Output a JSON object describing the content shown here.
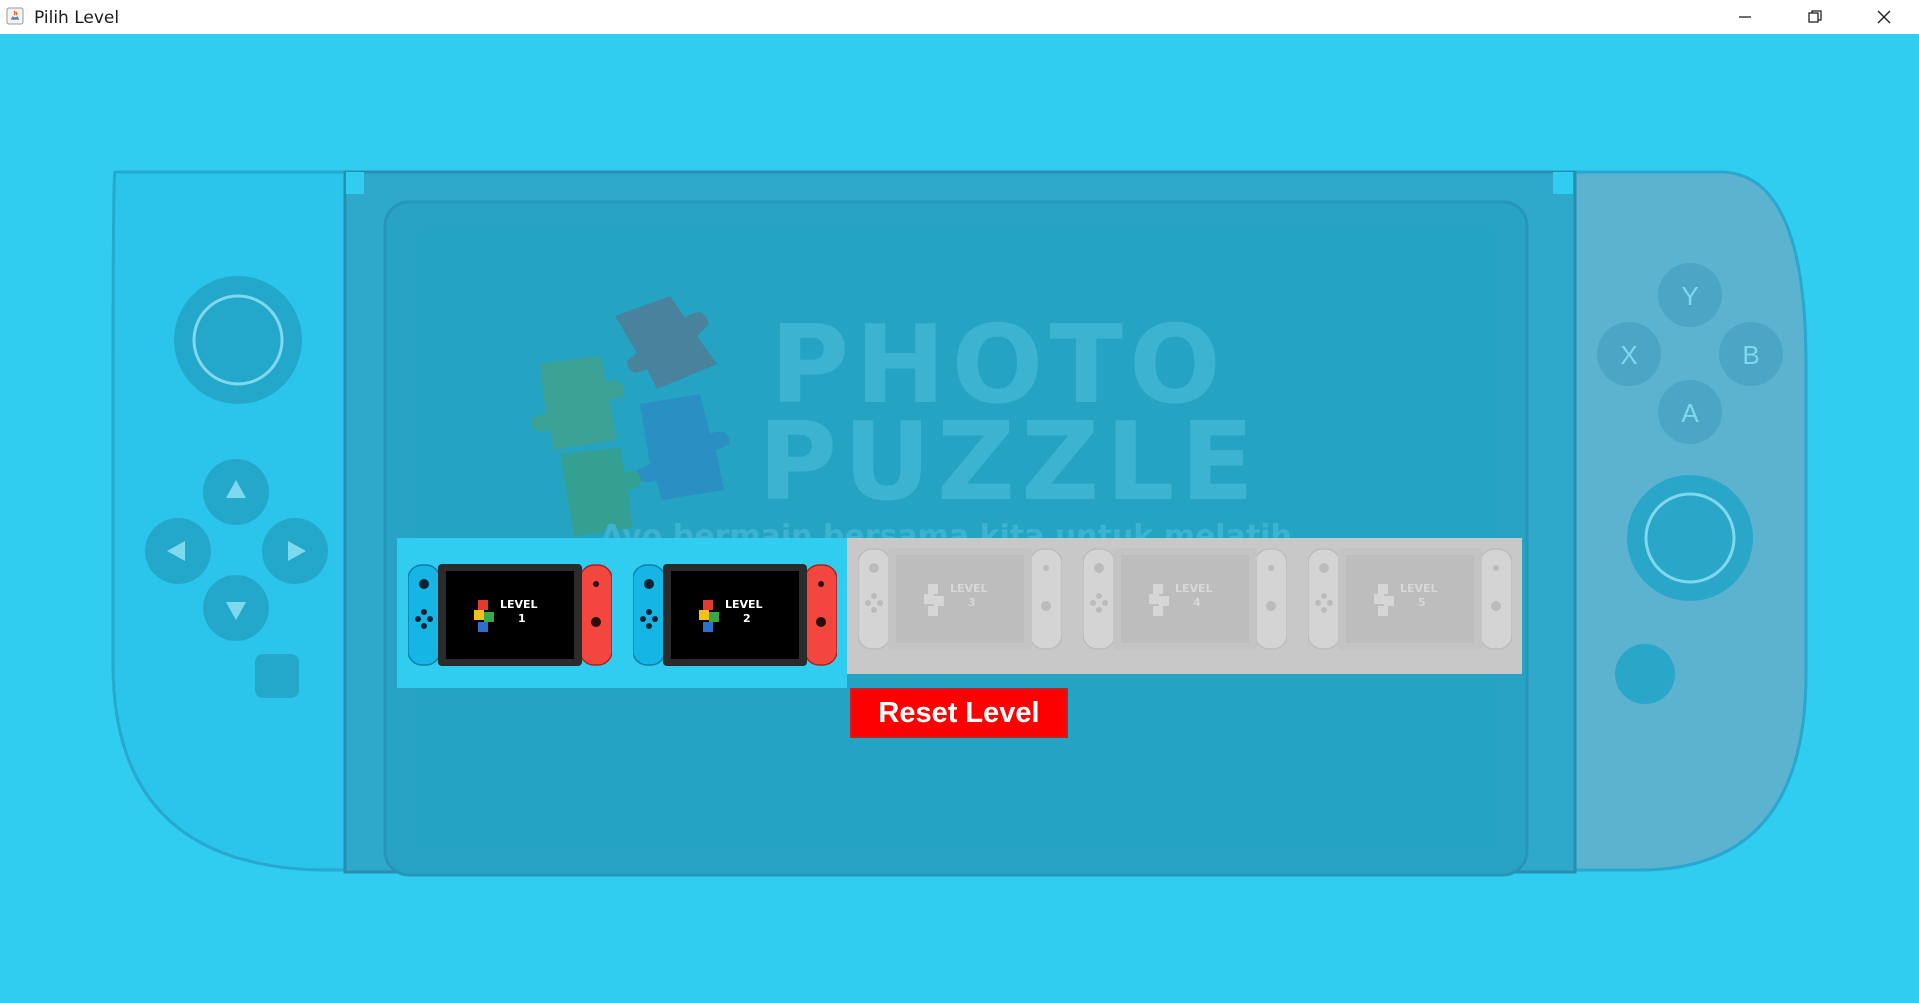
{
  "window": {
    "title": "Pilih Level",
    "controls": [
      "minimize",
      "restore",
      "close"
    ]
  },
  "background": {
    "title_line1": "PHOTO",
    "title_line2": "PUZZLE",
    "subtitle": "Ayo bermain bersama kita untuk melatih"
  },
  "controller": {
    "face_buttons": {
      "top": "Y",
      "left": "X",
      "right": "B",
      "bottom": "A"
    }
  },
  "levels": [
    {
      "label": "LEVEL",
      "number": "1",
      "unlocked": true
    },
    {
      "label": "LEVEL",
      "number": "2",
      "unlocked": true
    },
    {
      "label": "LEVEL",
      "number": "3",
      "unlocked": false
    },
    {
      "label": "LEVEL",
      "number": "4",
      "unlocked": false
    },
    {
      "label": "LEVEL",
      "number": "5",
      "unlocked": false
    }
  ],
  "reset_button": {
    "label": "Reset Level"
  },
  "colors": {
    "background": "#31cdf0",
    "console_body": "#2a9fc0",
    "screen": "#25a3c2",
    "reset": "#ff0000",
    "joycon_left": "#15b6e6",
    "joycon_right": "#f2463f"
  }
}
